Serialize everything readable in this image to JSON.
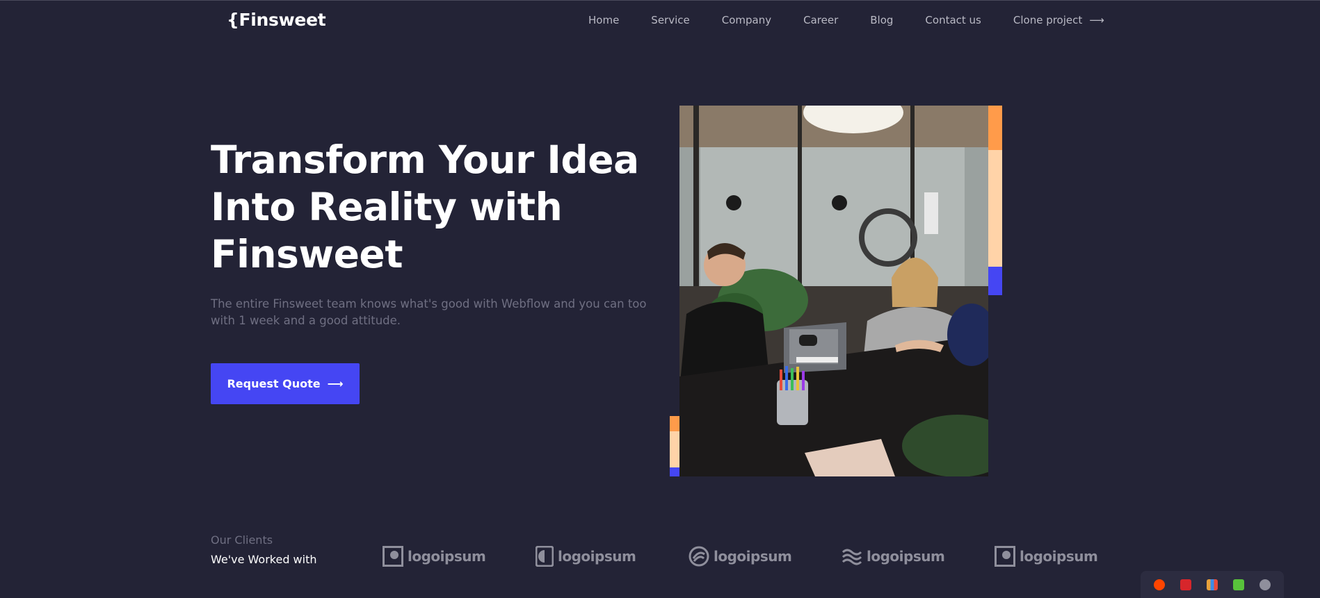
{
  "brand": {
    "logo_text": "{Finsweet"
  },
  "nav": {
    "items": [
      "Home",
      "Service",
      "Company",
      "Career",
      "Blog",
      "Contact us"
    ],
    "clone_label": "Clone project",
    "arrow": "⟶"
  },
  "hero": {
    "title": "Transform Your Idea Into Reality with Finsweet",
    "subtitle": "The entire Finsweet team knows what's good with Webflow and you can too with 1 week and a good attitude.",
    "cta_label": "Request Quote",
    "cta_arrow": "⟶",
    "image_icon": "office-meeting-photo"
  },
  "clients": {
    "label": "Our Clients",
    "title": "We've Worked with",
    "logos": [
      {
        "name": "logoipsum",
        "icon": "square-logo-icon"
      },
      {
        "name": "logoipsum",
        "icon": "half-circle-logo-icon"
      },
      {
        "name": "logoipsum",
        "icon": "wave-circle-logo-icon"
      },
      {
        "name": "logoipsum",
        "icon": "waves-logo-icon"
      },
      {
        "name": "logoipsum",
        "icon": "square-logo-icon"
      }
    ]
  },
  "colors": {
    "background": "#232336",
    "accent": "#4546f3",
    "orange": "#ff9b4a",
    "peach": "#ffd3a8",
    "muted_text": "#6f6f82"
  },
  "tray": {
    "icons": [
      "reddit-icon",
      "pdf-icon",
      "books-icon",
      "leaf-icon",
      "webcam-icon"
    ]
  }
}
